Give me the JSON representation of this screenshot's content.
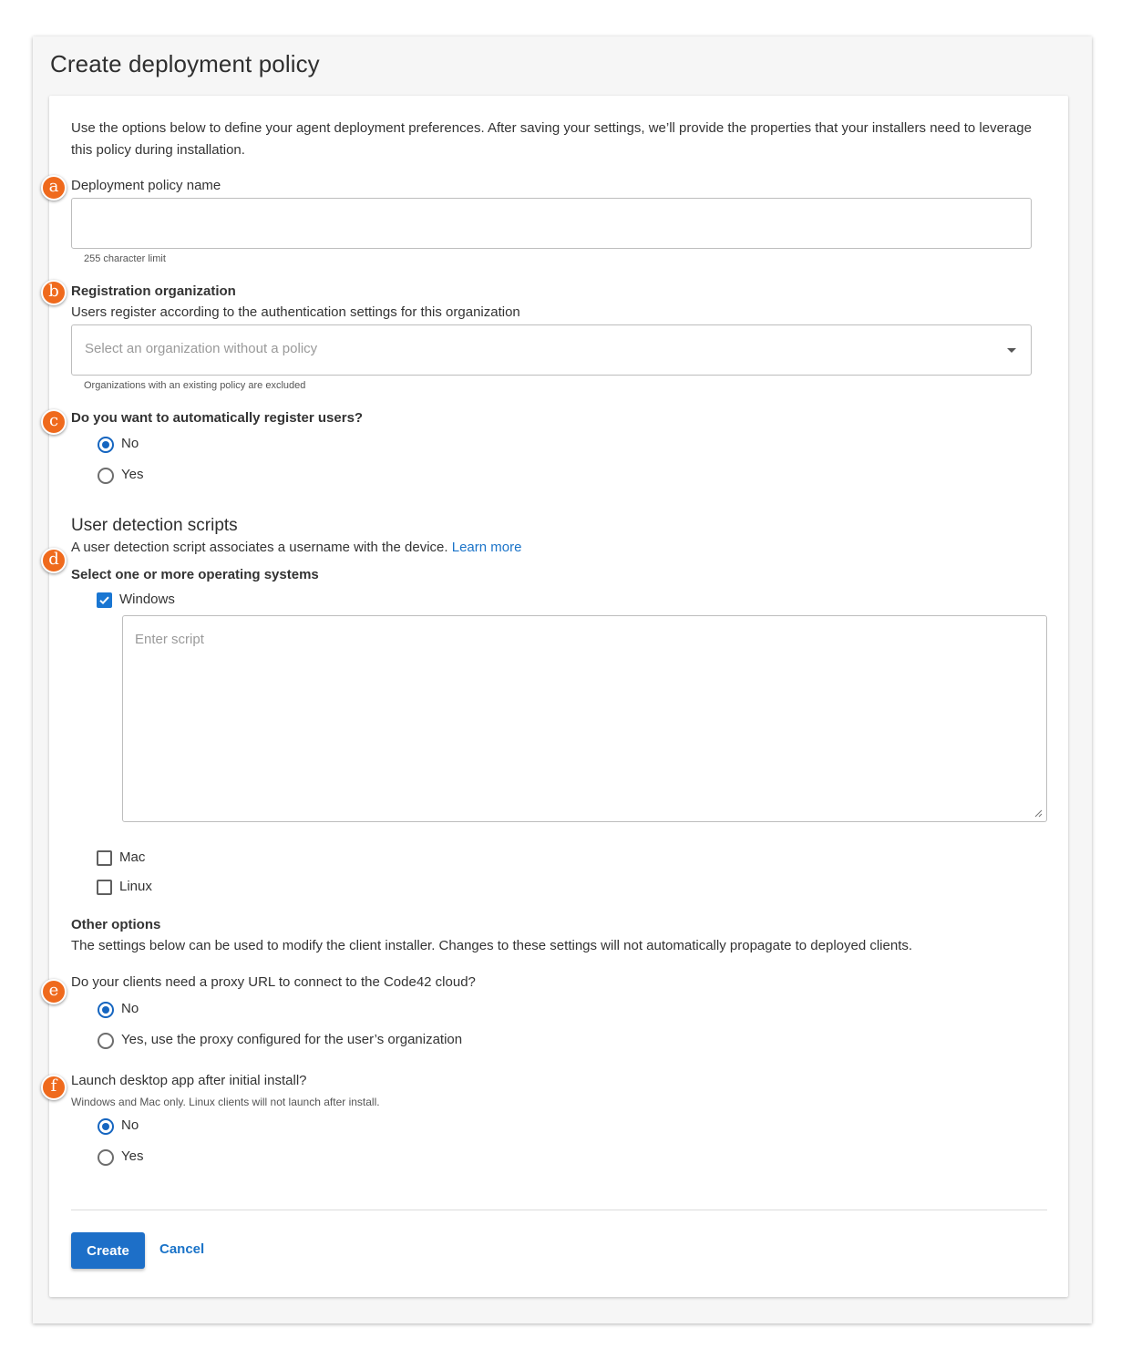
{
  "dialog": {
    "title": "Create deployment policy"
  },
  "intro": "Use the options below to define your agent deployment preferences. After saving your settings, we’ll provide the properties that your installers need to leverage this policy during installation.",
  "policy_name": {
    "label": "Deployment policy name",
    "value": "",
    "help": "255 character limit"
  },
  "registration_org": {
    "label": "Registration organization",
    "description": "Users register according to the authentication settings for this organization",
    "placeholder": "Select an organization without a policy",
    "help": "Organizations with an existing policy are excluded"
  },
  "auto_register": {
    "question": "Do you want to automatically register users?",
    "options": [
      {
        "label": "No",
        "selected": true
      },
      {
        "label": "Yes",
        "selected": false
      }
    ]
  },
  "user_detection": {
    "title": "User detection scripts",
    "description": "A user detection script associates a username with the device.",
    "learn_more": "Learn more",
    "os_label": "Select one or more operating systems",
    "os": [
      {
        "label": "Windows",
        "checked": true
      },
      {
        "label": "Mac",
        "checked": false
      },
      {
        "label": "Linux",
        "checked": false
      }
    ],
    "script_placeholder": "Enter script"
  },
  "other_options": {
    "title": "Other options",
    "description": "The settings below can be used to modify the client installer. Changes to these settings will not automatically propagate to deployed clients."
  },
  "proxy": {
    "question": "Do your clients need a proxy URL to connect to the Code42 cloud?",
    "options": [
      {
        "label": "No",
        "selected": true
      },
      {
        "label": "Yes, use the proxy configured for the user’s organization",
        "selected": false
      }
    ]
  },
  "launch_app": {
    "question": "Launch desktop app after initial install?",
    "help": "Windows and Mac only. Linux clients will not launch after install.",
    "options": [
      {
        "label": "No",
        "selected": true
      },
      {
        "label": "Yes",
        "selected": false
      }
    ]
  },
  "actions": {
    "create": "Create",
    "cancel": "Cancel"
  },
  "callouts": [
    "a",
    "b",
    "c",
    "d",
    "e",
    "f"
  ],
  "colors": {
    "primary": "#1d6fc8",
    "link": "#1a73c8",
    "callout": "#ef6a1d"
  }
}
